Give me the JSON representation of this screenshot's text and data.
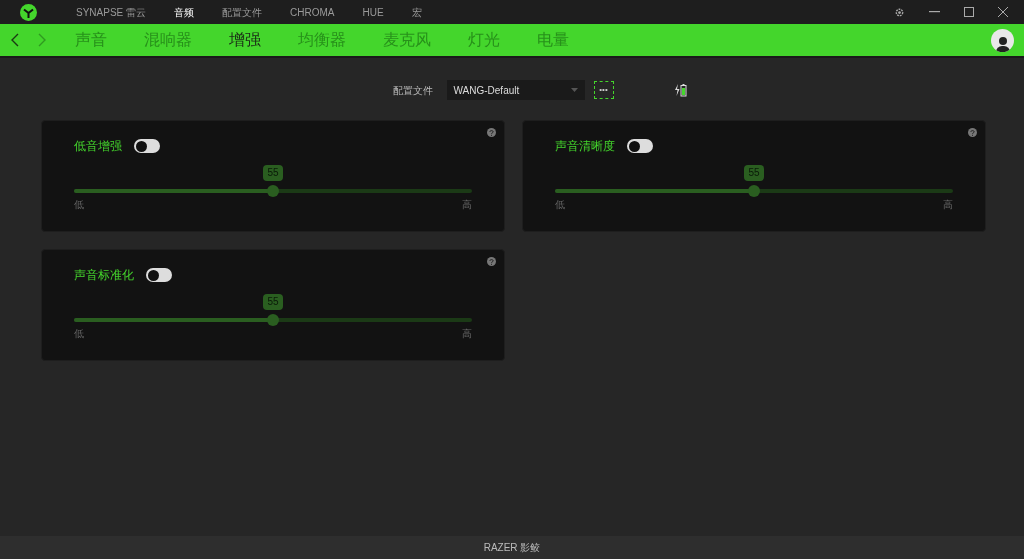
{
  "top_tabs": [
    {
      "label": "SYNAPSE 雷云",
      "selected": false
    },
    {
      "label": "音频",
      "selected": true
    },
    {
      "label": "配置文件",
      "selected": false
    },
    {
      "label": "CHROMA",
      "selected": false
    },
    {
      "label": "HUE",
      "selected": false
    },
    {
      "label": "宏",
      "selected": false
    }
  ],
  "sub_tabs": [
    {
      "label": "声音",
      "selected": false
    },
    {
      "label": "混响器",
      "selected": false
    },
    {
      "label": "增强",
      "selected": true
    },
    {
      "label": "均衡器",
      "selected": false
    },
    {
      "label": "麦克风",
      "selected": false
    },
    {
      "label": "灯光",
      "selected": false
    },
    {
      "label": "电量",
      "selected": false
    }
  ],
  "profile": {
    "label": "配置文件",
    "value": "WANG-Default",
    "more": "•••"
  },
  "cards": [
    {
      "title": "低音增强",
      "on": false,
      "value": "55",
      "level": 0.5,
      "min_label": "低",
      "max_label": "高"
    },
    {
      "title": "声音清晰度",
      "on": false,
      "value": "55",
      "level": 0.5,
      "min_label": "低",
      "max_label": "高"
    },
    {
      "title": "声音标准化",
      "on": false,
      "value": "55",
      "level": 0.5,
      "min_label": "低",
      "max_label": "高"
    }
  ],
  "footer": "RAZER 影鲛"
}
